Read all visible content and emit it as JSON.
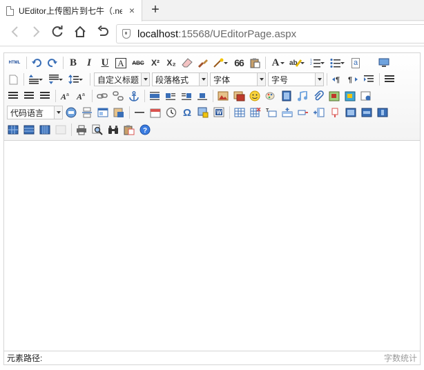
{
  "browser": {
    "tab_title": "UEditor上传图片到七牛（.ne",
    "close_glyph": "×",
    "new_tab_glyph": "+",
    "address": {
      "host": "localhost",
      "rest": ":15568/UEditorPage.aspx"
    }
  },
  "editor": {
    "toolbar": {
      "custom_title": "自定义标题",
      "paragraph_format": "段落格式",
      "font_family": "字体",
      "font_size": "字号",
      "code_language": "代码语言",
      "source_label": "HTML",
      "bold": "B",
      "italic": "I",
      "underline": "U",
      "font_border": "A",
      "strikethrough": "ABC",
      "superscript": "X²",
      "subscript": "X₂",
      "forecolor": "A",
      "blockquote": "66",
      "omega": "Ω",
      "help": "?"
    },
    "statusbar": {
      "element_path_label": "元素路径:",
      "word_count_label": "字数统计"
    }
  },
  "colors": {
    "accent_blue": "#3a6fb7",
    "toolbar_border": "#d4d4d4"
  }
}
